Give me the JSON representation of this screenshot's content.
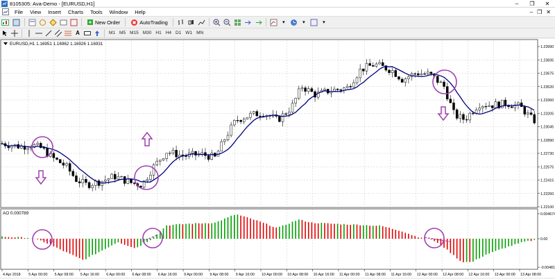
{
  "window": {
    "title": "8105305: Ava-Demo - [EURUSD,H1]",
    "min": "–",
    "max": "❐",
    "close": "✕"
  },
  "menu": [
    "File",
    "View",
    "Insert",
    "Charts",
    "Tools",
    "Window",
    "Help"
  ],
  "toolbar": {
    "new_order": "New Order",
    "autotrading": "AutoTrading"
  },
  "timeframes": [
    "M1",
    "M5",
    "M15",
    "M30",
    "H1",
    "H4",
    "D1",
    "W1",
    "MN"
  ],
  "chart": {
    "symbol_label": "EURUSD,H1  1.16951 1.16962 1.16926 1.16931",
    "indicator_label": "AO 0.000789",
    "price_ticks": [
      "1.23990",
      "1.23835",
      "1.23675",
      "1.23520",
      "1.23360",
      "1.23205",
      "1.23045",
      "1.22890",
      "1.22730",
      "1.22575",
      "1.22415",
      "1.22260",
      "1.22100"
    ],
    "ao_ticks": [
      "0.004674",
      "0.00",
      "-0.00481"
    ],
    "time_ticks": [
      "4 Apr 2018",
      "5 Apr 00:00",
      "5 Apr 08:00",
      "5 Apr 16:00",
      "6 Apr 00:00",
      "6 Apr 08:00",
      "6 Apr 16:00",
      "9 Apr 00:00",
      "9 Apr 08:00",
      "9 Apr 16:00",
      "10 Apr 00:00",
      "10 Apr 08:00",
      "10 Apr 16:00",
      "11 Apr 00:00",
      "11 Apr 08:00",
      "11 Apr 16:00",
      "12 Apr 00:00",
      "12 Apr 08:00",
      "12 Apr 16:00",
      "13 Apr 00:00",
      "13 Apr 08:00"
    ]
  },
  "colors": {
    "ao_up": "#00a000",
    "ao_down": "#e00000",
    "ma": "#000080",
    "annot": "#a040b0"
  }
}
